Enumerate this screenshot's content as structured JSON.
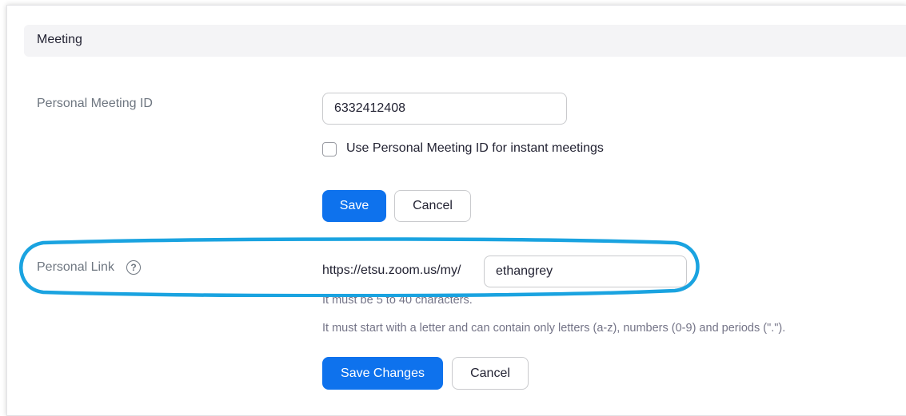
{
  "section": {
    "title": "Meeting"
  },
  "personal_meeting_id": {
    "label": "Personal Meeting ID",
    "value": "6332412408",
    "checkbox_label": "Use Personal Meeting ID for instant meetings",
    "checkbox_checked": false,
    "save_label": "Save",
    "cancel_label": "Cancel"
  },
  "personal_link": {
    "label": "Personal Link",
    "help_icon": "question-circle-icon",
    "help_glyph": "?",
    "url_prefix": "https://etsu.zoom.us/my/",
    "value": "ethangrey",
    "hint_length": "It must be 5 to 40 characters.",
    "hint_format": "It must start with a letter and can contain only letters (a-z), numbers (0-9) and periods (\".\").",
    "save_label": "Save Changes",
    "cancel_label": "Cancel"
  },
  "colors": {
    "primary": "#0e72ed",
    "annotation": "#1aa3e0",
    "label_gray": "#6e7680"
  }
}
